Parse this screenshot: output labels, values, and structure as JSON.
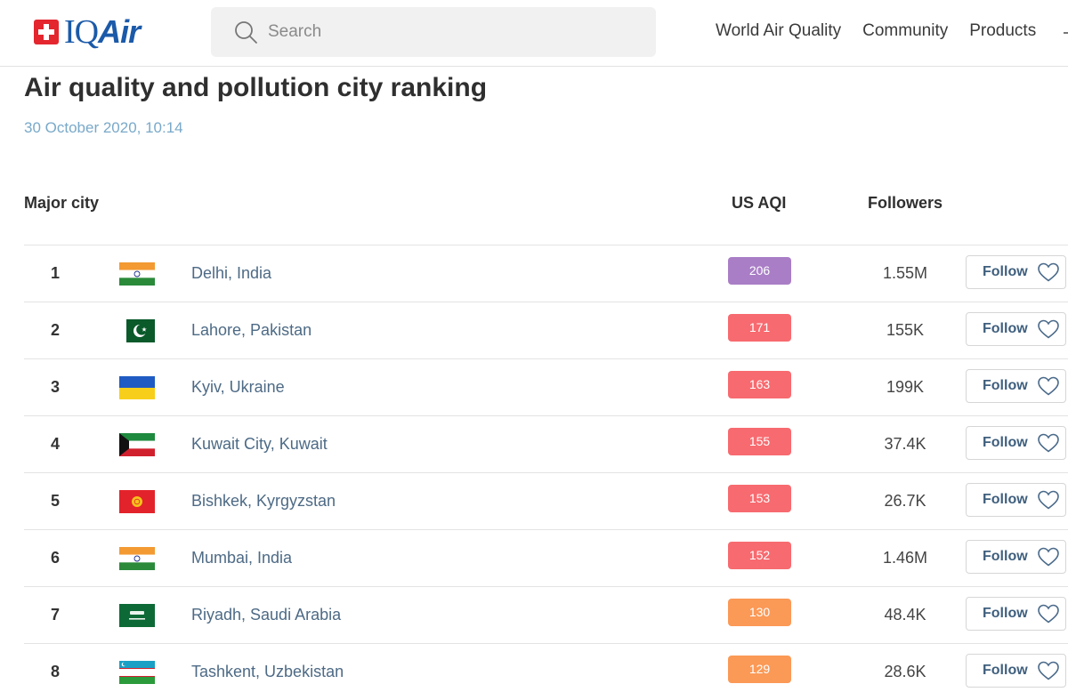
{
  "header": {
    "logo_text_iq": "IQ",
    "logo_text_air": "Air",
    "search_placeholder": "Search",
    "nav": [
      "World Air Quality",
      "Community",
      "Products"
    ]
  },
  "page": {
    "title": "Air quality and pollution city ranking",
    "date": "30 October 2020, 10:14"
  },
  "table": {
    "columns": {
      "city": "Major city",
      "aqi": "US AQI",
      "followers": "Followers"
    },
    "follow_label": "Follow",
    "rows": [
      {
        "rank": "1",
        "flag": "india",
        "city": "Delhi, India",
        "aqi": "206",
        "aqi_color": "#a97ec6",
        "followers": "1.55M"
      },
      {
        "rank": "2",
        "flag": "pakistan",
        "city": "Lahore, Pakistan",
        "aqi": "171",
        "aqi_color": "#f76a6f",
        "followers": "155K"
      },
      {
        "rank": "3",
        "flag": "ukraine",
        "city": "Kyiv, Ukraine",
        "aqi": "163",
        "aqi_color": "#f76a6f",
        "followers": "199K"
      },
      {
        "rank": "4",
        "flag": "kuwait",
        "city": "Kuwait City, Kuwait",
        "aqi": "155",
        "aqi_color": "#f76a6f",
        "followers": "37.4K"
      },
      {
        "rank": "5",
        "flag": "kyrgyzstan",
        "city": "Bishkek, Kyrgyzstan",
        "aqi": "153",
        "aqi_color": "#f76a6f",
        "followers": "26.7K"
      },
      {
        "rank": "6",
        "flag": "india",
        "city": "Mumbai, India",
        "aqi": "152",
        "aqi_color": "#f76a6f",
        "followers": "1.46M"
      },
      {
        "rank": "7",
        "flag": "saudi-arabia",
        "city": "Riyadh, Saudi Arabia",
        "aqi": "130",
        "aqi_color": "#fb9956",
        "followers": "48.4K"
      },
      {
        "rank": "8",
        "flag": "uzbekistan",
        "city": "Tashkent, Uzbekistan",
        "aqi": "129",
        "aqi_color": "#fb9956",
        "followers": "28.6K"
      }
    ]
  }
}
